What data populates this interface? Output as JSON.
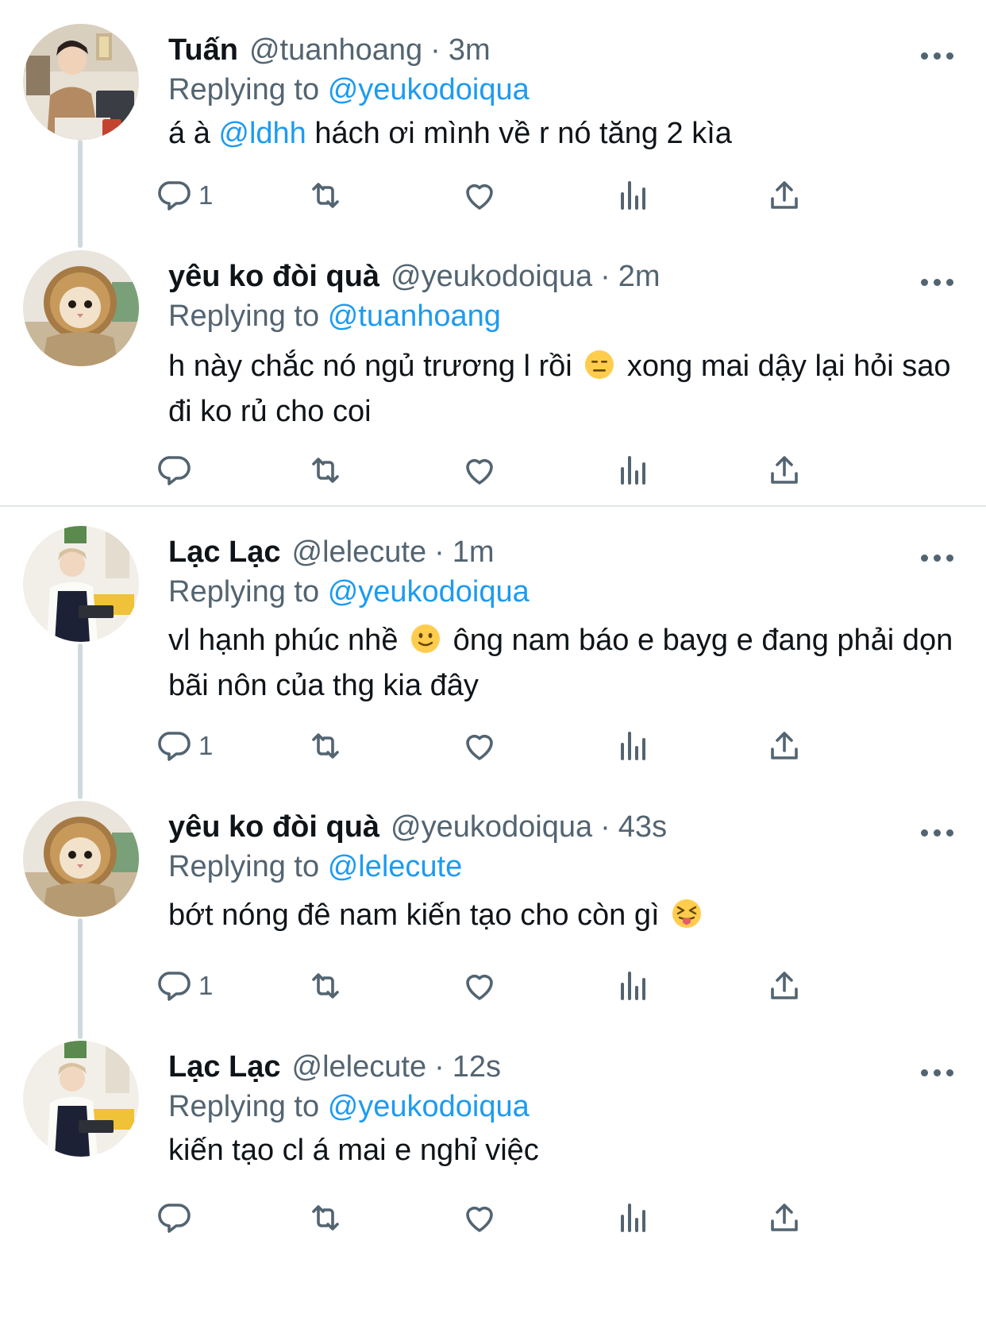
{
  "thread": {
    "tweets": [
      {
        "name": "Tuấn",
        "handle": "@tuanhoang",
        "dot": "·",
        "time": "3m",
        "replying_label": "Replying to",
        "replying_to": "@yeukodoiqua",
        "text_parts": [
          {
            "type": "text",
            "value": "á à "
          },
          {
            "type": "mention",
            "value": "@ldhh"
          },
          {
            "type": "text",
            "value": " hách ơi mình về r nó tăng 2 kìa"
          }
        ],
        "reply_count": "1",
        "avatar": "man-at-laptop"
      },
      {
        "name": "yêu ko đòi quà",
        "handle": "@yeukodoiqua",
        "dot": "·",
        "time": "2m",
        "replying_label": "Replying to",
        "replying_to": "@tuanhoang",
        "text_parts": [
          {
            "type": "text",
            "value": "h này chắc nó ngủ trương l rồi "
          },
          {
            "type": "emoji",
            "value": "expressionless-face-emoji"
          },
          {
            "type": "text",
            "value": " xong mai dậy lại hỏi sao đi ko rủ cho coi"
          }
        ],
        "reply_count": "",
        "avatar": "cat-lion-mane"
      },
      {
        "name": "Lạc Lạc",
        "handle": "@lelecute",
        "dot": "·",
        "time": "1m",
        "replying_label": "Replying to",
        "replying_to": "@yeukodoiqua",
        "text_parts": [
          {
            "type": "text",
            "value": "vl hạnh phúc nhề "
          },
          {
            "type": "emoji",
            "value": "slightly-smiling-face-emoji"
          },
          {
            "type": "text",
            "value": " ông nam báo e bayg e đang phải dọn bãi nôn của thg kia đây"
          }
        ],
        "reply_count": "1",
        "avatar": "person-with-apron"
      },
      {
        "name": "yêu ko đòi quà",
        "handle": "@yeukodoiqua",
        "dot": "·",
        "time": "43s",
        "replying_label": "Replying to",
        "replying_to": "@lelecute",
        "text_parts": [
          {
            "type": "text",
            "value": "bớt nóng đê nam kiến tạo cho còn gì "
          },
          {
            "type": "emoji",
            "value": "squinting-face-with-tongue-emoji"
          }
        ],
        "reply_count": "1",
        "avatar": "cat-lion-mane"
      },
      {
        "name": "Lạc Lạc",
        "handle": "@lelecute",
        "dot": "·",
        "time": "12s",
        "replying_label": "Replying to",
        "replying_to": "@yeukodoiqua",
        "text_parts": [
          {
            "type": "text",
            "value": "kiến tạo cl á mai e nghỉ việc"
          }
        ],
        "reply_count": "",
        "avatar": "person-with-apron"
      }
    ]
  },
  "icons": {
    "reply": "reply-bubble-icon",
    "retweet": "retweet-icon",
    "like": "heart-icon",
    "views": "analytics-icon",
    "share": "share-icon",
    "more": "more-dots-icon"
  },
  "colors": {
    "text": "#0f1419",
    "secondary": "#536471",
    "mention": "#1d9bf0",
    "thread_line": "#cfd9de"
  }
}
